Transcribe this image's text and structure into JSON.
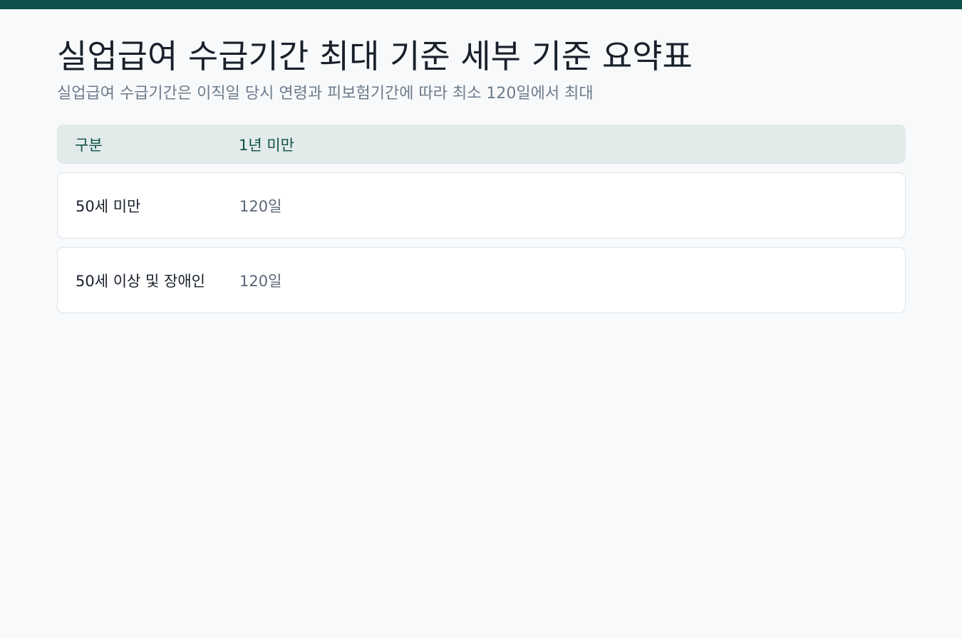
{
  "header": {
    "title": "실업급여 수급기간 최대 기준 세부 기준 요약표",
    "subtitle": "실업급여 수급기간은 이직일 당시 연령과 피보험기간에 따라 최소 120일에서 최대"
  },
  "table": {
    "columns": [
      "구분",
      "1년 미만"
    ],
    "rows": [
      {
        "label": "50세 미만",
        "value": "120일"
      },
      {
        "label": "50세 이상 및 장애인",
        "value": "120일"
      }
    ]
  },
  "colors": {
    "accent": "#0f514a",
    "background": "#f7f9fa",
    "header_bg": "#e2eaea"
  }
}
